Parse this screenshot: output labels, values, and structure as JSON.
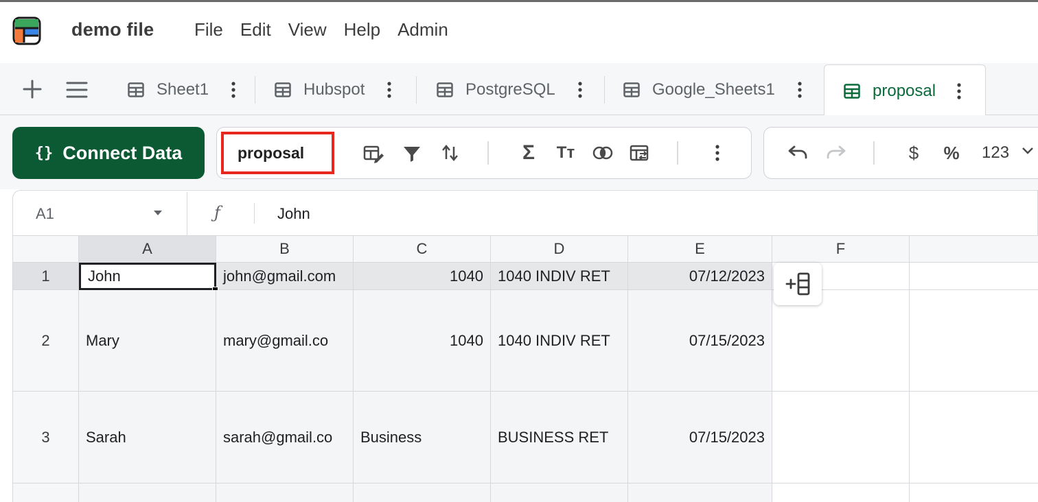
{
  "app": {
    "doc_title": "demo file",
    "menu": [
      "File",
      "Edit",
      "View",
      "Help",
      "Admin"
    ]
  },
  "tabs": [
    {
      "label": "Sheet1",
      "active": false
    },
    {
      "label": "Hubspot",
      "active": false
    },
    {
      "label": "PostgreSQL",
      "active": false
    },
    {
      "label": "Google_Sheets1",
      "active": false
    },
    {
      "label": "proposal",
      "active": true
    }
  ],
  "toolbar": {
    "connect_label": "Connect Data",
    "connect_braces": "{}",
    "sheet_name": "proposal",
    "number_format": "123",
    "icons": [
      "edit-table-icon",
      "filter-icon",
      "sort-icon",
      "sum-icon",
      "text-format-icon",
      "merge-icon",
      "transform-icon",
      "more-icon",
      "undo-icon",
      "redo-icon",
      "dollar-icon",
      "percent-icon"
    ],
    "dollar": "$",
    "percent": "%",
    "sigma": "Σ",
    "text_size": "Tт"
  },
  "formula_bar": {
    "cell_ref": "A1",
    "fx": "ƒ",
    "value": "John"
  },
  "grid": {
    "columns": [
      "A",
      "B",
      "C",
      "D",
      "E",
      "F",
      ""
    ],
    "rows": [
      {
        "num": "1",
        "cells": [
          "John",
          "john@gmail.com",
          "1040",
          "1040 INDIV RET",
          "07/12/2023"
        ]
      },
      {
        "num": "2",
        "cells": [
          "Mary",
          "mary@gmail.co",
          "1040",
          "1040 INDIV RET",
          "07/15/2023"
        ]
      },
      {
        "num": "3",
        "cells": [
          "Sarah",
          "sarah@gmail.co",
          "Business",
          "BUSINESS RET",
          "07/15/2023"
        ]
      }
    ]
  },
  "colors": {
    "accent_green": "#0b5a34",
    "tab_active_text": "#0b6b3a",
    "highlight_red": "#e8281e"
  }
}
